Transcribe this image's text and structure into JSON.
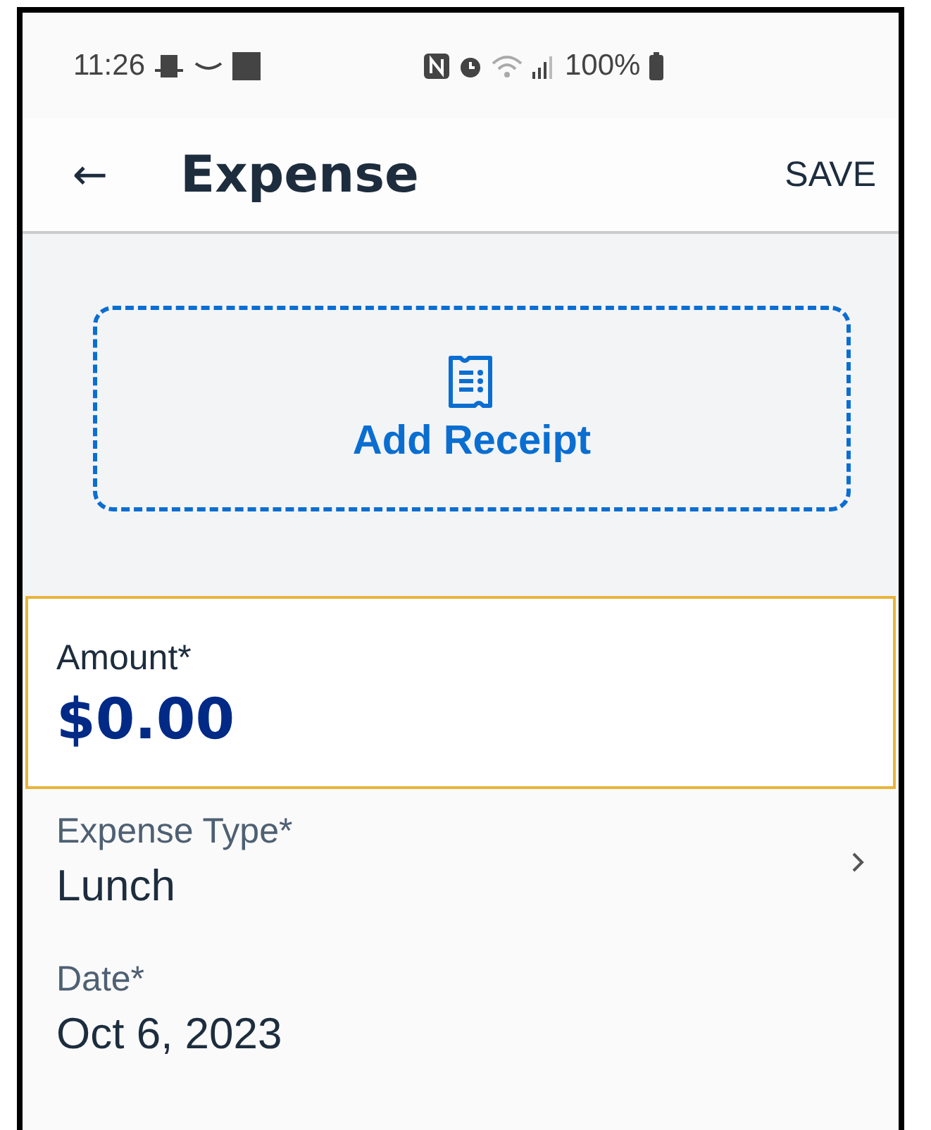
{
  "status_bar": {
    "time": "11:26",
    "battery": "100%"
  },
  "header": {
    "back": "←",
    "title": "Expense",
    "action": "SAVE"
  },
  "receipt": {
    "label": "Add Receipt"
  },
  "fields": [
    {
      "kind": "amount",
      "label": "Amount*",
      "value": "$0.00",
      "focused": true
    },
    {
      "kind": "picker",
      "label": "Expense Type*",
      "value": "Lunch",
      "focused": false
    },
    {
      "kind": "date",
      "label": "Date*",
      "value": "Oct 6, 2023",
      "focused": false
    }
  ]
}
